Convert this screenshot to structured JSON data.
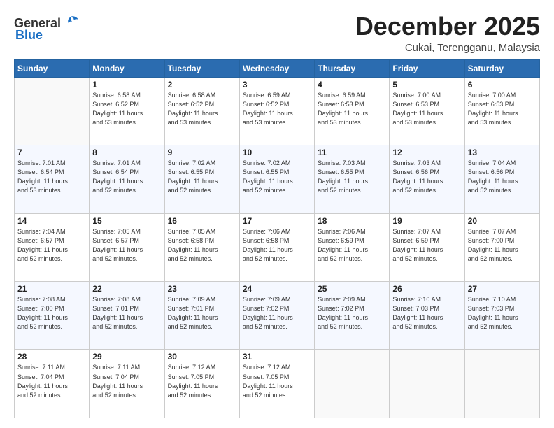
{
  "header": {
    "logo_general": "General",
    "logo_blue": "Blue",
    "month": "December 2025",
    "location": "Cukai, Terengganu, Malaysia"
  },
  "days_of_week": [
    "Sunday",
    "Monday",
    "Tuesday",
    "Wednesday",
    "Thursday",
    "Friday",
    "Saturday"
  ],
  "weeks": [
    [
      {
        "day": "",
        "sunrise": "",
        "sunset": "",
        "daylight": ""
      },
      {
        "day": "1",
        "sunrise": "6:58 AM",
        "sunset": "6:52 PM",
        "daylight": "11 hours and 53 minutes."
      },
      {
        "day": "2",
        "sunrise": "6:58 AM",
        "sunset": "6:52 PM",
        "daylight": "11 hours and 53 minutes."
      },
      {
        "day": "3",
        "sunrise": "6:59 AM",
        "sunset": "6:52 PM",
        "daylight": "11 hours and 53 minutes."
      },
      {
        "day": "4",
        "sunrise": "6:59 AM",
        "sunset": "6:53 PM",
        "daylight": "11 hours and 53 minutes."
      },
      {
        "day": "5",
        "sunrise": "7:00 AM",
        "sunset": "6:53 PM",
        "daylight": "11 hours and 53 minutes."
      },
      {
        "day": "6",
        "sunrise": "7:00 AM",
        "sunset": "6:53 PM",
        "daylight": "11 hours and 53 minutes."
      }
    ],
    [
      {
        "day": "7",
        "sunrise": "7:01 AM",
        "sunset": "6:54 PM",
        "daylight": "11 hours and 53 minutes."
      },
      {
        "day": "8",
        "sunrise": "7:01 AM",
        "sunset": "6:54 PM",
        "daylight": "11 hours and 52 minutes."
      },
      {
        "day": "9",
        "sunrise": "7:02 AM",
        "sunset": "6:55 PM",
        "daylight": "11 hours and 52 minutes."
      },
      {
        "day": "10",
        "sunrise": "7:02 AM",
        "sunset": "6:55 PM",
        "daylight": "11 hours and 52 minutes."
      },
      {
        "day": "11",
        "sunrise": "7:03 AM",
        "sunset": "6:55 PM",
        "daylight": "11 hours and 52 minutes."
      },
      {
        "day": "12",
        "sunrise": "7:03 AM",
        "sunset": "6:56 PM",
        "daylight": "11 hours and 52 minutes."
      },
      {
        "day": "13",
        "sunrise": "7:04 AM",
        "sunset": "6:56 PM",
        "daylight": "11 hours and 52 minutes."
      }
    ],
    [
      {
        "day": "14",
        "sunrise": "7:04 AM",
        "sunset": "6:57 PM",
        "daylight": "11 hours and 52 minutes."
      },
      {
        "day": "15",
        "sunrise": "7:05 AM",
        "sunset": "6:57 PM",
        "daylight": "11 hours and 52 minutes."
      },
      {
        "day": "16",
        "sunrise": "7:05 AM",
        "sunset": "6:58 PM",
        "daylight": "11 hours and 52 minutes."
      },
      {
        "day": "17",
        "sunrise": "7:06 AM",
        "sunset": "6:58 PM",
        "daylight": "11 hours and 52 minutes."
      },
      {
        "day": "18",
        "sunrise": "7:06 AM",
        "sunset": "6:59 PM",
        "daylight": "11 hours and 52 minutes."
      },
      {
        "day": "19",
        "sunrise": "7:07 AM",
        "sunset": "6:59 PM",
        "daylight": "11 hours and 52 minutes."
      },
      {
        "day": "20",
        "sunrise": "7:07 AM",
        "sunset": "7:00 PM",
        "daylight": "11 hours and 52 minutes."
      }
    ],
    [
      {
        "day": "21",
        "sunrise": "7:08 AM",
        "sunset": "7:00 PM",
        "daylight": "11 hours and 52 minutes."
      },
      {
        "day": "22",
        "sunrise": "7:08 AM",
        "sunset": "7:01 PM",
        "daylight": "11 hours and 52 minutes."
      },
      {
        "day": "23",
        "sunrise": "7:09 AM",
        "sunset": "7:01 PM",
        "daylight": "11 hours and 52 minutes."
      },
      {
        "day": "24",
        "sunrise": "7:09 AM",
        "sunset": "7:02 PM",
        "daylight": "11 hours and 52 minutes."
      },
      {
        "day": "25",
        "sunrise": "7:09 AM",
        "sunset": "7:02 PM",
        "daylight": "11 hours and 52 minutes."
      },
      {
        "day": "26",
        "sunrise": "7:10 AM",
        "sunset": "7:03 PM",
        "daylight": "11 hours and 52 minutes."
      },
      {
        "day": "27",
        "sunrise": "7:10 AM",
        "sunset": "7:03 PM",
        "daylight": "11 hours and 52 minutes."
      }
    ],
    [
      {
        "day": "28",
        "sunrise": "7:11 AM",
        "sunset": "7:04 PM",
        "daylight": "11 hours and 52 minutes."
      },
      {
        "day": "29",
        "sunrise": "7:11 AM",
        "sunset": "7:04 PM",
        "daylight": "11 hours and 52 minutes."
      },
      {
        "day": "30",
        "sunrise": "7:12 AM",
        "sunset": "7:05 PM",
        "daylight": "11 hours and 52 minutes."
      },
      {
        "day": "31",
        "sunrise": "7:12 AM",
        "sunset": "7:05 PM",
        "daylight": "11 hours and 52 minutes."
      },
      {
        "day": "",
        "sunrise": "",
        "sunset": "",
        "daylight": ""
      },
      {
        "day": "",
        "sunrise": "",
        "sunset": "",
        "daylight": ""
      },
      {
        "day": "",
        "sunrise": "",
        "sunset": "",
        "daylight": ""
      }
    ]
  ]
}
